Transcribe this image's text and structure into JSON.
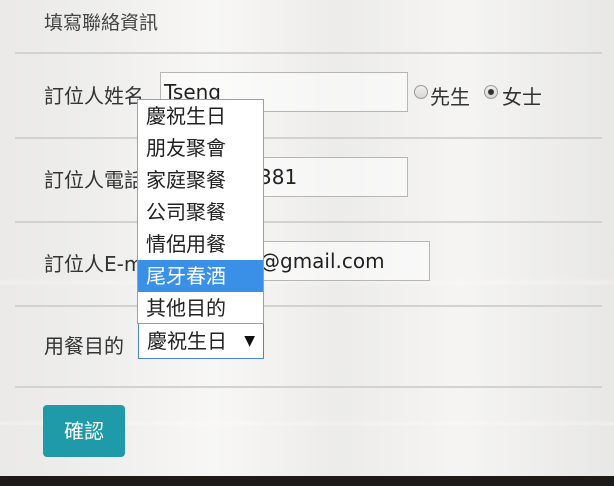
{
  "form": {
    "heading": "填寫聯絡資訊",
    "name_label": "訂位人姓名",
    "name_value": "Tseng",
    "gender_options": [
      "先生",
      "女士"
    ],
    "gender_selected": "女士",
    "phone_label": "訂位人電話",
    "phone_value": "381",
    "email_label": "訂位人E-mail",
    "email_value": "@gmail.com",
    "purpose_label": "用餐目的",
    "purpose_selected": "慶祝生日",
    "purpose_arrow": "▼",
    "purpose_options": [
      "慶祝生日",
      "朋友聚會",
      "家庭聚餐",
      "公司聚餐",
      "情侶用餐",
      "尾牙春酒",
      "其他目的"
    ],
    "purpose_highlighted": "尾牙春酒",
    "submit_label": "確認"
  },
  "colors": {
    "button_bg": "#1f9aa8",
    "highlight_bg": "#3a8fe6",
    "select_border": "#4a86d8"
  }
}
